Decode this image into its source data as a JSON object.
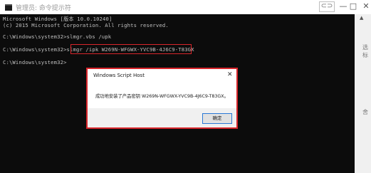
{
  "window": {
    "title": "管理员: 命令提示符",
    "controls": {
      "extra": "⊂⊃",
      "minimize": "—",
      "maximize": "□",
      "close": "✕"
    }
  },
  "console": {
    "lines": [
      "Microsoft Windows [版本 10.0.10240]",
      "(c) 2015 Microsoft Corporation. All rights reserved.",
      "C:\\Windows\\system32>slmgr.vbs /upk",
      "C:\\Windows\\system32>slmgr /ipk W269N-WFGWX-YVC9B-4J6C9-T83GX",
      "C:\\Windows\\system32>"
    ],
    "colors": {
      "background": "#0c0c0c",
      "text": "#c0c0c0",
      "highlight": "#d8262b"
    }
  },
  "dialog": {
    "title": "Windows Script Host",
    "close": "✕",
    "message": "成功地安装了产品密钥 W269N-WFGWX-YVC9B-4J6C9-T83GX。",
    "ok_label": "确定"
  },
  "side_marks": [
    "选",
    "标",
    "舍"
  ],
  "scrollbar": {
    "up_arrow": "▲"
  }
}
